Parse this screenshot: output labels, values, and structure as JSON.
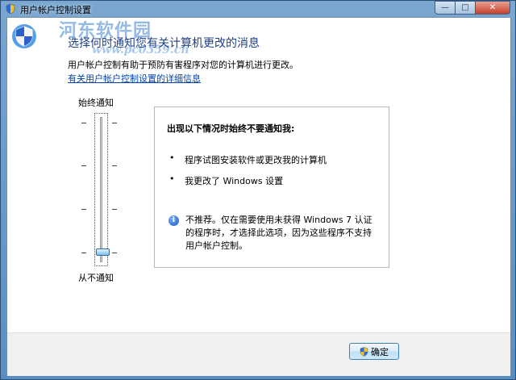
{
  "window": {
    "title": "用户帐户控制设置",
    "min_glyph": "—",
    "max_glyph": "□",
    "close_glyph": "✕"
  },
  "header": {
    "icon": "uac-shield-icon",
    "heading": "选择何时通知您有关计算机更改的消息",
    "description": "用户帐户控制有助于预防有害程序对您的计算机进行更改。",
    "help_link": "有关用户帐户控制设置的详细信息"
  },
  "slider": {
    "top_label": "始终通知",
    "bottom_label": "从不通知",
    "levels": 4,
    "selected_level": 1,
    "selected_level_note": "level 1 of 4 (bottom = never notify)"
  },
  "info_panel": {
    "title": "出现以下情况时始终不要通知我:",
    "bullets": [
      "程序试图安装软件或更改我的计算机",
      "我更改了 Windows 设置"
    ],
    "note_icon": "info-icon",
    "note": "不推荐。仅在需要使用未获得 Windows 7 认证的程序时，才选择此选项，因为这些程序不支持用户帐户控制。"
  },
  "footer": {
    "ok_label": "确定",
    "ok_icon": "uac-shield-icon"
  },
  "watermark": {
    "text1": "河东软件园",
    "text2": "www.pc0359.cn"
  },
  "colors": {
    "heading": "#1e3f8a",
    "link": "#0645ad",
    "frame": "#5b8ec0"
  }
}
